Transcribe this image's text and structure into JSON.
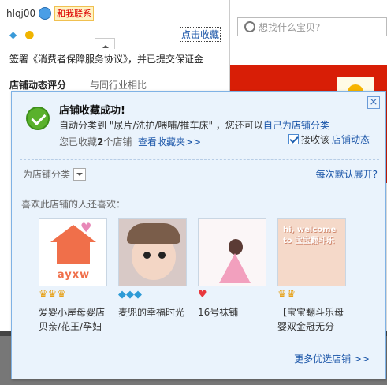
{
  "store_header": {
    "username": "hlqj00",
    "contact_label": "和我联系",
    "favorite_link": "点击收藏",
    "agreement_text": "签署《消费者保障服务协议》，并已提交保证金",
    "rating_title": "店铺动态评分",
    "rating_compare": "与同行业相比"
  },
  "search": {
    "placeholder": "想找什么宝贝?"
  },
  "popup": {
    "title": "店铺收藏成功!",
    "line1_prefix": "自动分类到 \"尿片/洗护/喂哺/推车床\" ，您还可以",
    "line1_link": "自己为店铺分类",
    "line2_prefix": "您已收藏",
    "line2_count": "2",
    "line2_suffix": "个店铺",
    "line2_link": "查看收藏夹>>",
    "receive_label_prefix": "接收该",
    "receive_label_link": "店铺动态",
    "receive_checked": true,
    "category_label": "为店铺分类",
    "expand_label": "每次默认展开?",
    "also_like_label": "喜欢此店铺的人还喜欢：",
    "more_link": "更多优选店铺 >>",
    "shops": [
      {
        "name": "爱婴小屋母婴店 贝亲/花王/孕妇",
        "badge_icon": "crown-icon",
        "badge_count": 3,
        "thumb_text": "ayxw"
      },
      {
        "name": "麦兜的幸福时光",
        "badge_icon": "diamond-icon",
        "badge_count": 3,
        "thumb_text": ""
      },
      {
        "name": "16号袜铺",
        "badge_icon": "heart-icon",
        "badge_count": 1,
        "thumb_text": ""
      },
      {
        "name": "【宝宝翻斗乐母婴双金冠无分",
        "badge_icon": "crown-icon",
        "badge_count": 2,
        "thumb_text": "hi, welcome to 宝宝翻斗乐"
      }
    ]
  },
  "colors": {
    "accent_link": "#1a55a8",
    "popup_bg": "#eaf3fc",
    "success_green": "#5ab12c",
    "banner_red": "#d81e06"
  }
}
